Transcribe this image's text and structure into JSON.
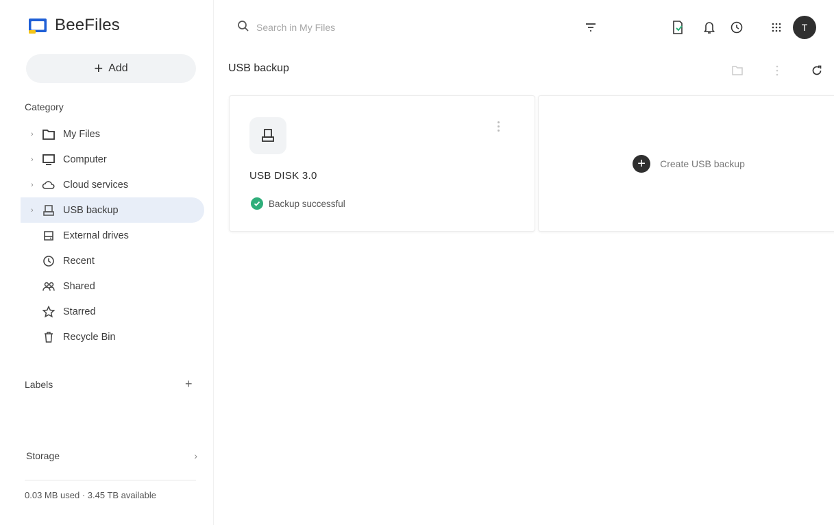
{
  "app": {
    "name": "BeeFiles"
  },
  "sidebar": {
    "add_label": "Add",
    "category_label": "Category",
    "items": [
      {
        "label": "My Files",
        "icon": "folder-icon",
        "expandable": true,
        "active": false
      },
      {
        "label": "Computer",
        "icon": "computer-icon",
        "expandable": true,
        "active": false
      },
      {
        "label": "Cloud services",
        "icon": "cloud-icon",
        "expandable": true,
        "active": false
      },
      {
        "label": "USB backup",
        "icon": "usb-drive-icon",
        "expandable": true,
        "active": true
      },
      {
        "label": "External drives",
        "icon": "external-drive-icon",
        "expandable": false,
        "active": false
      },
      {
        "label": "Recent",
        "icon": "clock-icon",
        "expandable": false,
        "active": false
      },
      {
        "label": "Shared",
        "icon": "shared-icon",
        "expandable": false,
        "active": false
      },
      {
        "label": "Starred",
        "icon": "star-icon",
        "expandable": false,
        "active": false
      },
      {
        "label": "Recycle Bin",
        "icon": "trash-icon",
        "expandable": false,
        "active": false
      }
    ],
    "labels_label": "Labels",
    "storage_label": "Storage",
    "storage_text": "0.03 MB used · 3.45 TB available"
  },
  "search": {
    "placeholder": "Search in My Files"
  },
  "main": {
    "title": "USB backup",
    "card": {
      "name": "USB DISK 3.0",
      "status": "Backup successful"
    },
    "create_label": "Create USB backup"
  },
  "user": {
    "initial": "T"
  },
  "colors": {
    "accent_active_bg": "#e8eef8",
    "success": "#2fae7a",
    "dark": "#2f2f2f",
    "logo_blue": "#1f5fd6",
    "logo_yellow": "#f5c518"
  }
}
